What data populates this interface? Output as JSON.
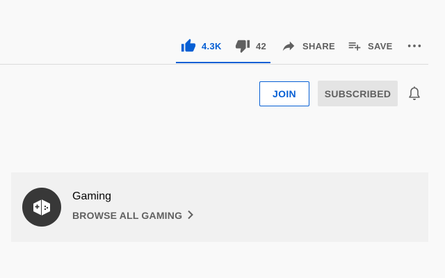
{
  "actions": {
    "like_count": "4.3K",
    "dislike_count": "42",
    "share_label": "SHARE",
    "save_label": "SAVE"
  },
  "channel": {
    "join_label": "JOIN",
    "subscribed_label": "SUBSCRIBED"
  },
  "category": {
    "title": "Gaming",
    "browse_label": "BROWSE ALL GAMING"
  },
  "icons": {
    "like": "thumb-up-icon",
    "dislike": "thumb-down-icon",
    "share": "share-arrow-icon",
    "save": "playlist-add-icon",
    "more": "more-horizontal-icon",
    "bell": "bell-icon",
    "gaming": "gamepad-icon",
    "browse": "chevron-right-icon"
  },
  "colors": {
    "accent": "#065fd4",
    "muted": "#606060",
    "background": "#f9f9f9",
    "card": "#f1f1f1"
  }
}
